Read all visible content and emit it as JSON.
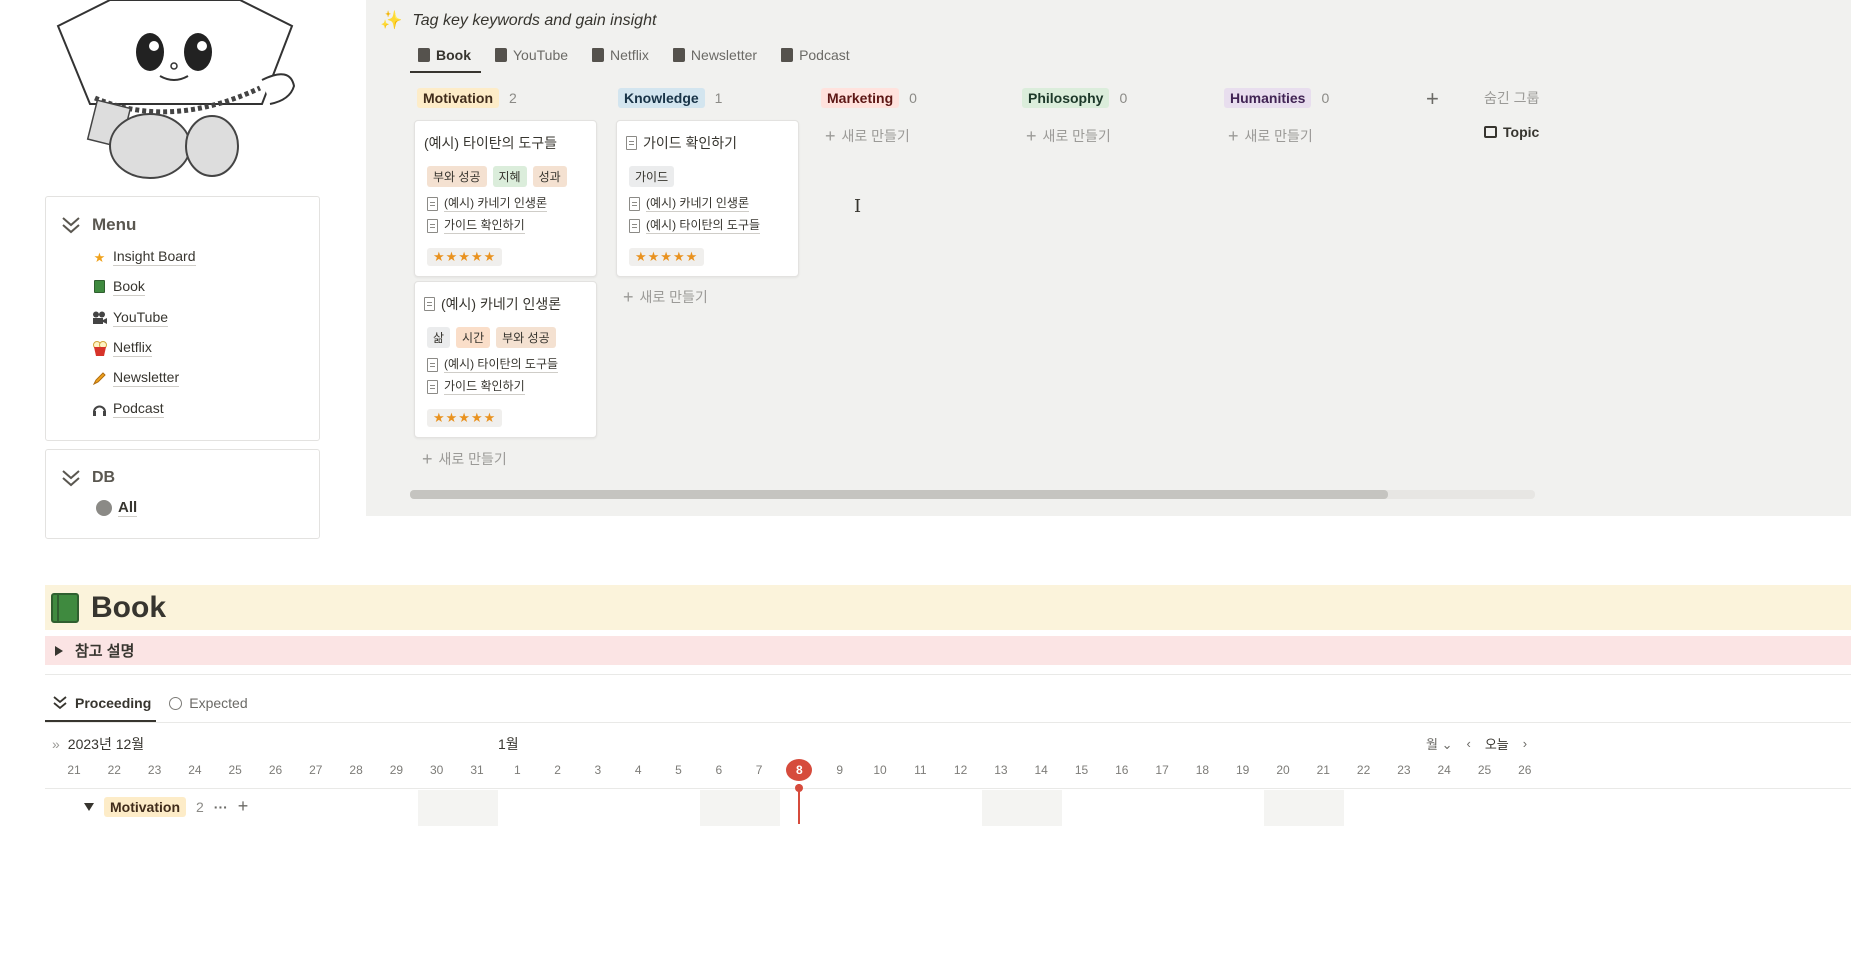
{
  "menu": {
    "title": "Menu",
    "items": [
      {
        "label": "Insight Board",
        "icon": "star-icon"
      },
      {
        "label": "Book",
        "icon": "green-book-icon"
      },
      {
        "label": "YouTube",
        "icon": "movie-camera-icon"
      },
      {
        "label": "Netflix",
        "icon": "popcorn-icon"
      },
      {
        "label": "Newsletter",
        "icon": "pencil-icon"
      },
      {
        "label": "Podcast",
        "icon": "headphones-icon"
      }
    ]
  },
  "db": {
    "title": "DB",
    "all_label": "All"
  },
  "board": {
    "title": "Tag key keywords and gain insight",
    "tabs": [
      "Book",
      "YouTube",
      "Netflix",
      "Newsletter",
      "Podcast"
    ],
    "new_label": "새로 만들기",
    "columns": [
      {
        "name": "Motivation",
        "count": "2",
        "bg": "#fdecc8",
        "fg": "#402c1b"
      },
      {
        "name": "Knowledge",
        "count": "1",
        "bg": "#d3e5ef",
        "fg": "#183347"
      },
      {
        "name": "Marketing",
        "count": "0",
        "bg": "#ffe2dd",
        "fg": "#5d1715"
      },
      {
        "name": "Philosophy",
        "count": "0",
        "bg": "#dbeddb",
        "fg": "#1c3829"
      },
      {
        "name": "Humanities",
        "count": "0",
        "bg": "#e8deee",
        "fg": "#412454"
      }
    ],
    "hidden_group_label": "숨긴 그룹",
    "topic_label": "Topic",
    "cards": [
      {
        "title": "(예시) 타이탄의 도구들",
        "tags": [
          {
            "t": "부와 성공",
            "bg": "#f4e1d1"
          },
          {
            "t": "지혜",
            "bg": "#dbeddb"
          },
          {
            "t": "성과",
            "bg": "#f4e1d1"
          }
        ],
        "links": [
          "(예시) 카네기 인생론",
          "가이드 확인하기"
        ],
        "stars": "★★★★★"
      },
      {
        "title": "(예시) 카네기 인생론",
        "tags": [
          {
            "t": "삶",
            "bg": "#ebeced"
          },
          {
            "t": "시간",
            "bg": "#fadec9"
          },
          {
            "t": "부와 성공",
            "bg": "#f4e1d1"
          }
        ],
        "links": [
          "(예시) 타이탄의 도구들",
          "가이드 확인하기"
        ],
        "stars": "★★★★★"
      },
      {
        "title": "가이드 확인하기",
        "tags": [
          {
            "t": "가이드",
            "bg": "#ebeced"
          }
        ],
        "links": [
          "(예시) 카네기 인생론",
          "(예시) 타이탄의 도구들"
        ],
        "stars": "★★★★★"
      }
    ]
  },
  "book_section": {
    "title": "Book",
    "note": "참고 설명",
    "views": [
      "Proceeding",
      "Expected"
    ]
  },
  "timeline": {
    "month_left": "2023년 12월",
    "month_center": "1월",
    "period": "월",
    "today_label": "오늘",
    "days": [
      "21",
      "22",
      "23",
      "24",
      "25",
      "26",
      "27",
      "28",
      "29",
      "30",
      "31",
      "1",
      "2",
      "3",
      "4",
      "5",
      "6",
      "7",
      "8",
      "9",
      "10",
      "11",
      "12",
      "13",
      "14",
      "15",
      "16",
      "17",
      "18",
      "19",
      "20",
      "21",
      "22",
      "23",
      "24",
      "25",
      "26"
    ],
    "today": "8",
    "group": {
      "name": "Motivation",
      "count": "2"
    }
  }
}
